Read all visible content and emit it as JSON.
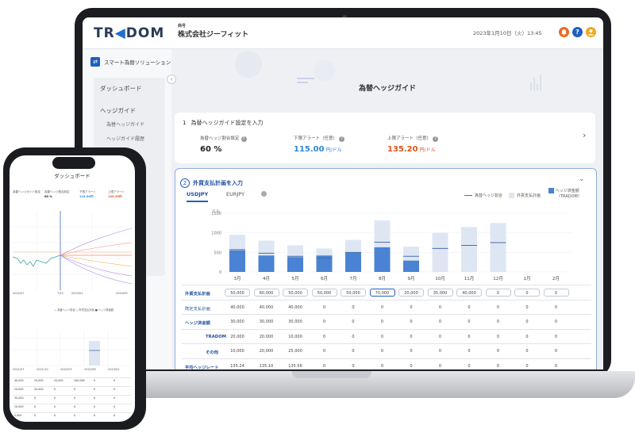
{
  "colors": {
    "brand_blue": "#1f5fbf",
    "bar_dark": "#4a82d4",
    "bar_light": "#dfe6f3",
    "current_red": "#e2541b",
    "lower_blue": "#2f86d8",
    "bell_orange": "#ee6a22",
    "user_yellow": "#f2a91b"
  },
  "header": {
    "logo_left": "TR",
    "logo_right": "DOM",
    "company_sub": "商号",
    "company": "株式会社ジーフィット",
    "datetime": "2023年1月10日（火）13:45",
    "icons": [
      "bell-icon",
      "help-icon",
      "user-icon"
    ],
    "help_glyph": "?"
  },
  "sidebar": {
    "top_label": "スマート為替ソリューション",
    "items": [
      "ダッシュボード",
      "ヘッジガイド"
    ],
    "subitems": [
      "為替ヘッジガイド",
      "ヘッジガイド履歴"
    ]
  },
  "main": {
    "page_title": "為替ヘッジガイド",
    "section1": {
      "num": "1",
      "title": "為替ヘッジガイド設定を入力",
      "metrics": [
        {
          "label": "為替ヘッジ割合設定",
          "value": "60 %",
          "unit": ""
        },
        {
          "label": "下限アラート（任意）",
          "value": "115.00",
          "unit": "円/ドル"
        },
        {
          "label": "上限アラート（任意）",
          "value": "135.20",
          "unit": "円/ドル"
        }
      ]
    },
    "section2": {
      "num": "2",
      "title": "外貨支払計画を入力",
      "tabs": [
        "USDJPY",
        "EURJPY"
      ],
      "legend": [
        "為替ヘッジ割合",
        "外貨支払計画",
        "ヘッジ済金額",
        "（TRADOM）"
      ]
    }
  },
  "chart_data": {
    "type": "bar",
    "unit_label": "ドル",
    "ylim": [
      0,
      1500
    ],
    "yticks": [
      0,
      500,
      1000,
      1500
    ],
    "categories": [
      "3月",
      "4月",
      "5月",
      "6月",
      "7月",
      "8月",
      "9月",
      "10月",
      "11月",
      "12月",
      "1月",
      "2月"
    ],
    "series": [
      {
        "name": "外貨支払計画",
        "values": [
          950,
          800,
          680,
          600,
          820,
          1320,
          650,
          1000,
          1150,
          1250,
          0,
          0
        ]
      },
      {
        "name": "ヘッジ済金額",
        "values": [
          550,
          420,
          380,
          420,
          500,
          630,
          290,
          0,
          0,
          0,
          0,
          0
        ]
      },
      {
        "name": "為替ヘッジ割合",
        "values": [
          570,
          480,
          400,
          360,
          500,
          760,
          400,
          600,
          680,
          750,
          0,
          0
        ]
      }
    ]
  },
  "table": {
    "rows": [
      {
        "label": "外貨支払計画",
        "boxed": true,
        "values": [
          "50,000",
          "60,000",
          "50,000",
          "50,000",
          "50,000",
          "70,000",
          "20,000",
          "35,000",
          "40,000",
          "0",
          "0",
          "0"
        ]
      },
      {
        "label": "既定支払計画",
        "boxed": false,
        "values": [
          "40,000",
          "40,000",
          "40,000",
          "0",
          "0",
          "0",
          "0",
          "0",
          "0",
          "0",
          "0",
          "0"
        ]
      },
      {
        "label": "ヘッジ済金額",
        "boxed": false,
        "values": [
          "30,000",
          "30,000",
          "30,000",
          "0",
          "0",
          "0",
          "0",
          "0",
          "0",
          "0",
          "0",
          "0"
        ]
      },
      {
        "label": "TRADOM",
        "boxed": false,
        "values": [
          "20,000",
          "20,000",
          "10,000",
          "0",
          "0",
          "0",
          "0",
          "0",
          "0",
          "0",
          "0",
          "0"
        ]
      },
      {
        "label": "その他",
        "boxed": false,
        "values": [
          "10,000",
          "20,000",
          "25,000",
          "0",
          "0",
          "0",
          "0",
          "0",
          "0",
          "0",
          "0",
          "0"
        ]
      },
      {
        "label": "平均ヘッジレート",
        "boxed": false,
        "values": [
          "135.24",
          "135.10",
          "135.56",
          "0",
          "0",
          "0",
          "0",
          "0",
          "0",
          "0",
          "0",
          "0"
        ]
      }
    ]
  },
  "phone": {
    "title": "ダッシュボード",
    "metrics": [
      {
        "label": "為替ヘッジガイド設定",
        "value": ""
      },
      {
        "label": "為替ヘッジ割合設定",
        "value": "60 %"
      },
      {
        "label": "下限アラート",
        "value": "115.00円"
      },
      {
        "label": "上限アラート",
        "value": "135.20円"
      }
    ],
    "dates": [
      "2022/07",
      "7/12",
      "2023/01",
      "2024/09"
    ],
    "legend": "— 為替ヘッジ割合 □ 外貨支払計画 ■ ヘッジ済金額",
    "x_labels": [
      "2021/07",
      "2021/10",
      "2022/03",
      "2022/06",
      "2023/01"
    ],
    "rows": [
      [
        "40,000",
        "20,000",
        "20,000",
        "100,000",
        "0",
        "0"
      ],
      [
        "20,000",
        "20,000",
        "0",
        "0",
        "0",
        "0"
      ],
      [
        "30,000",
        "0",
        "0",
        "0",
        "0",
        "0"
      ],
      [
        "10,000",
        "0",
        "0",
        "0",
        "0",
        "0"
      ],
      [
        "5,000",
        "0",
        "0",
        "0",
        "0",
        "0"
      ]
    ]
  }
}
